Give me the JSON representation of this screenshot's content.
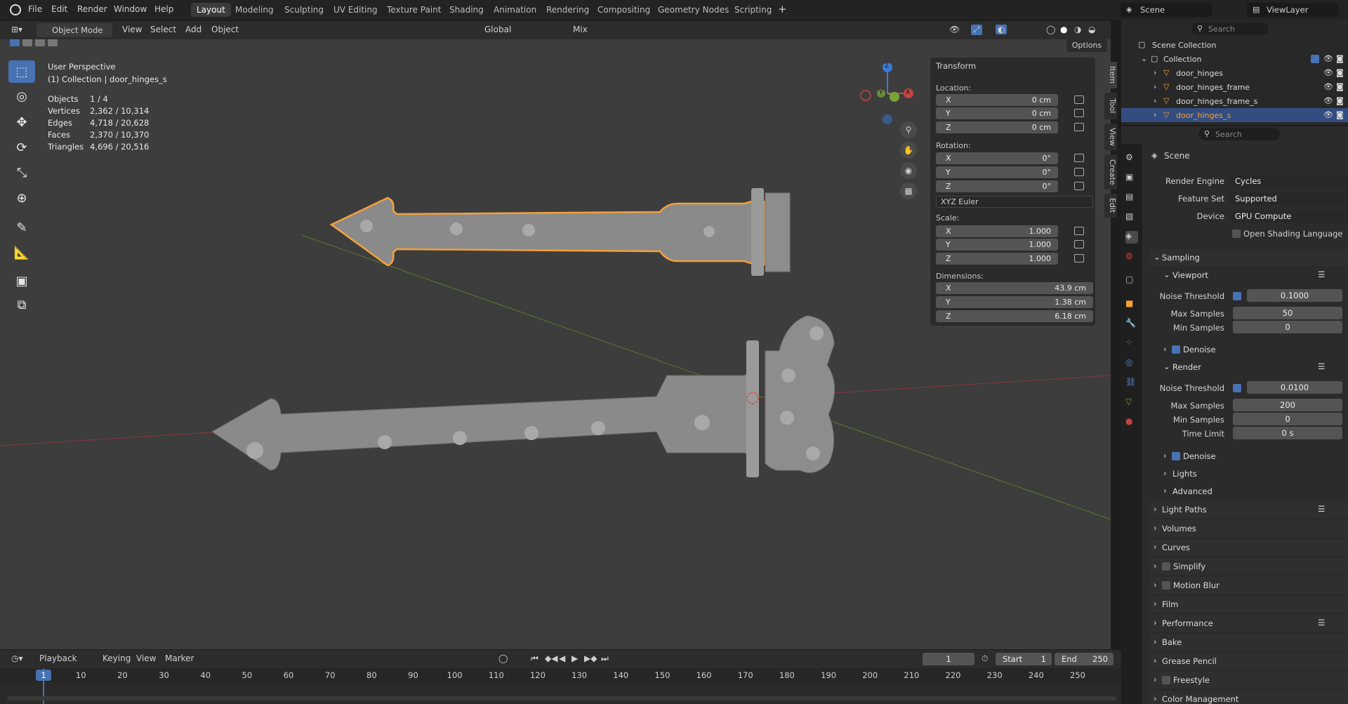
{
  "menu": [
    "File",
    "Edit",
    "Render",
    "Window",
    "Help"
  ],
  "workspaces": [
    "Layout",
    "Modeling",
    "Sculpting",
    "UV Editing",
    "Texture Paint",
    "Shading",
    "Animation",
    "Rendering",
    "Compositing",
    "Geometry Nodes",
    "Scripting"
  ],
  "active_workspace": "Layout",
  "scene": {
    "name": "Scene",
    "view_layer": "ViewLayer"
  },
  "viewport_header": {
    "mode": "Object Mode",
    "view": "View",
    "select": "Select",
    "add": "Add",
    "object": "Object",
    "orientation": "Global",
    "pivot": "Mix",
    "options": "Options"
  },
  "overlay": {
    "view_name": "User Perspective",
    "collection": "(1) Collection | door_hinges_s",
    "stats": [
      {
        "label": "Objects",
        "value": "1 / 4"
      },
      {
        "label": "Vertices",
        "value": "2,362 / 10,314"
      },
      {
        "label": "Edges",
        "value": "4,718 / 20,628"
      },
      {
        "label": "Faces",
        "value": "2,370 / 10,370"
      },
      {
        "label": "Triangles",
        "value": "4,696 / 20,516"
      }
    ]
  },
  "gizmo": {
    "x": "X",
    "y": "Y",
    "z": "Z"
  },
  "npanel": {
    "title": "Transform",
    "location_label": "Location:",
    "location": [
      {
        "axis": "X",
        "value": "0 cm"
      },
      {
        "axis": "Y",
        "value": "0 cm"
      },
      {
        "axis": "Z",
        "value": "0 cm"
      }
    ],
    "rotation_label": "Rotation:",
    "rotation": [
      {
        "axis": "X",
        "value": "0°"
      },
      {
        "axis": "Y",
        "value": "0°"
      },
      {
        "axis": "Z",
        "value": "0°"
      }
    ],
    "rotation_mode": "XYZ Euler",
    "scale_label": "Scale:",
    "scale": [
      {
        "axis": "X",
        "value": "1.000"
      },
      {
        "axis": "Y",
        "value": "1.000"
      },
      {
        "axis": "Z",
        "value": "1.000"
      }
    ],
    "dimensions_label": "Dimensions:",
    "dimensions": [
      {
        "axis": "X",
        "value": "43.9 cm"
      },
      {
        "axis": "Y",
        "value": "1.38 cm"
      },
      {
        "axis": "Z",
        "value": "6.18 cm"
      }
    ],
    "tabs": [
      "Item",
      "Tool",
      "View",
      "Create",
      "Edit"
    ]
  },
  "outliner": {
    "search_placeholder": "Search",
    "root": "Scene Collection",
    "collection": "Collection",
    "objects": [
      "door_hinges",
      "door_hinges_frame",
      "door_hinges_frame_s",
      "door_hinges_s"
    ],
    "selected": "door_hinges_s"
  },
  "properties": {
    "search_placeholder": "Search",
    "context": "Scene",
    "render_engine_label": "Render Engine",
    "render_engine": "Cycles",
    "feature_set_label": "Feature Set",
    "feature_set": "Supported",
    "device_label": "Device",
    "device": "GPU Compute",
    "osl_label": "Open Shading Language",
    "sampling": "Sampling",
    "viewport": "Viewport",
    "vp_noise_label": "Noise Threshold",
    "vp_noise": "0.1000",
    "vp_max_label": "Max Samples",
    "vp_max": "50",
    "vp_min_label": "Min Samples",
    "vp_min": "0",
    "denoise": "Denoise",
    "render": "Render",
    "r_noise_label": "Noise Threshold",
    "r_noise": "0.0100",
    "r_max_label": "Max Samples",
    "r_max": "200",
    "r_min_label": "Min Samples",
    "r_min": "0",
    "r_time_label": "Time Limit",
    "r_time": "0 s",
    "lights": "Lights",
    "advanced": "Advanced",
    "panels": [
      "Light Paths",
      "Volumes",
      "Curves",
      "Simplify",
      "Motion Blur",
      "Film",
      "Performance",
      "Bake",
      "Grease Pencil",
      "Freestyle",
      "Color Management"
    ]
  },
  "timeline": {
    "playback": "Playback",
    "keying": "Keying",
    "view": "View",
    "marker": "Marker",
    "current_frame": "1",
    "start_label": "Start",
    "start": "1",
    "end_label": "End",
    "end": "250",
    "ticks": [
      "1",
      "10",
      "20",
      "30",
      "40",
      "50",
      "60",
      "70",
      "80",
      "90",
      "100",
      "110",
      "120",
      "130",
      "140",
      "150",
      "160",
      "170",
      "180",
      "190",
      "200",
      "210",
      "220",
      "230",
      "240",
      "250"
    ]
  },
  "colors": {
    "accent": "#4772b3",
    "selection": "#f5a03a",
    "x_axis": "#c64343",
    "y_axis": "#7aa23b",
    "z_axis": "#3c7ad6"
  }
}
